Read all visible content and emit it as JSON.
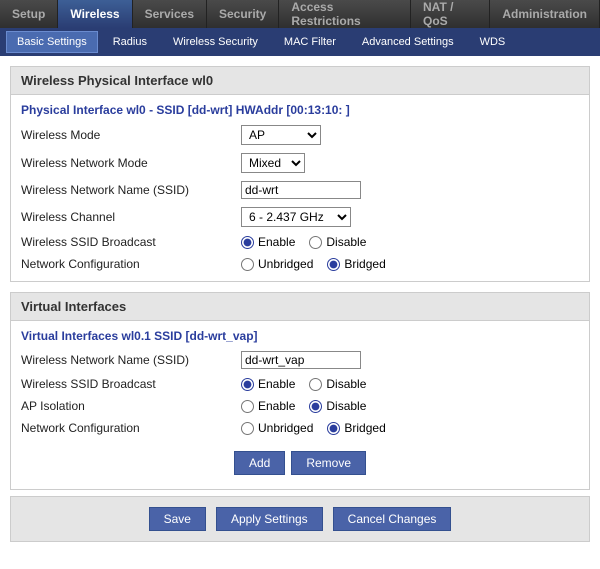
{
  "topnav": {
    "items": [
      "Setup",
      "Wireless",
      "Services",
      "Security",
      "Access Restrictions",
      "NAT / QoS",
      "Administration"
    ]
  },
  "subnav": {
    "items": [
      "Basic Settings",
      "Radius",
      "Wireless Security",
      "MAC Filter",
      "Advanced Settings",
      "WDS"
    ]
  },
  "panel1": {
    "header": "Wireless Physical Interface wl0",
    "fieldset_title": "Physical Interface wl0 - SSID [dd-wrt] HWAddr [00:13:10:              ]",
    "rows": {
      "mode_label": "Wireless Mode",
      "mode_value": "AP",
      "netmode_label": "Wireless Network Mode",
      "netmode_value": "Mixed",
      "ssid_label": "Wireless Network Name (SSID)",
      "ssid_value": "dd-wrt",
      "channel_label": "Wireless Channel",
      "channel_value": "6 - 2.437 GHz",
      "broadcast_label": "Wireless SSID Broadcast",
      "enable": "Enable",
      "disable": "Disable",
      "netcfg_label": "Network Configuration",
      "unbridged": "Unbridged",
      "bridged": "Bridged"
    }
  },
  "panel2": {
    "header": "Virtual Interfaces",
    "fieldset_title": "Virtual Interfaces wl0.1 SSID [dd-wrt_vap]",
    "rows": {
      "ssid_label": "Wireless Network Name (SSID)",
      "ssid_value": "dd-wrt_vap",
      "broadcast_label": "Wireless SSID Broadcast",
      "ap_iso_label": "AP Isolation",
      "netcfg_label": "Network Configuration",
      "enable": "Enable",
      "disable": "Disable",
      "unbridged": "Unbridged",
      "bridged": "Bridged"
    }
  },
  "buttons": {
    "add": "Add",
    "remove": "Remove",
    "save": "Save",
    "apply": "Apply Settings",
    "cancel": "Cancel Changes"
  }
}
